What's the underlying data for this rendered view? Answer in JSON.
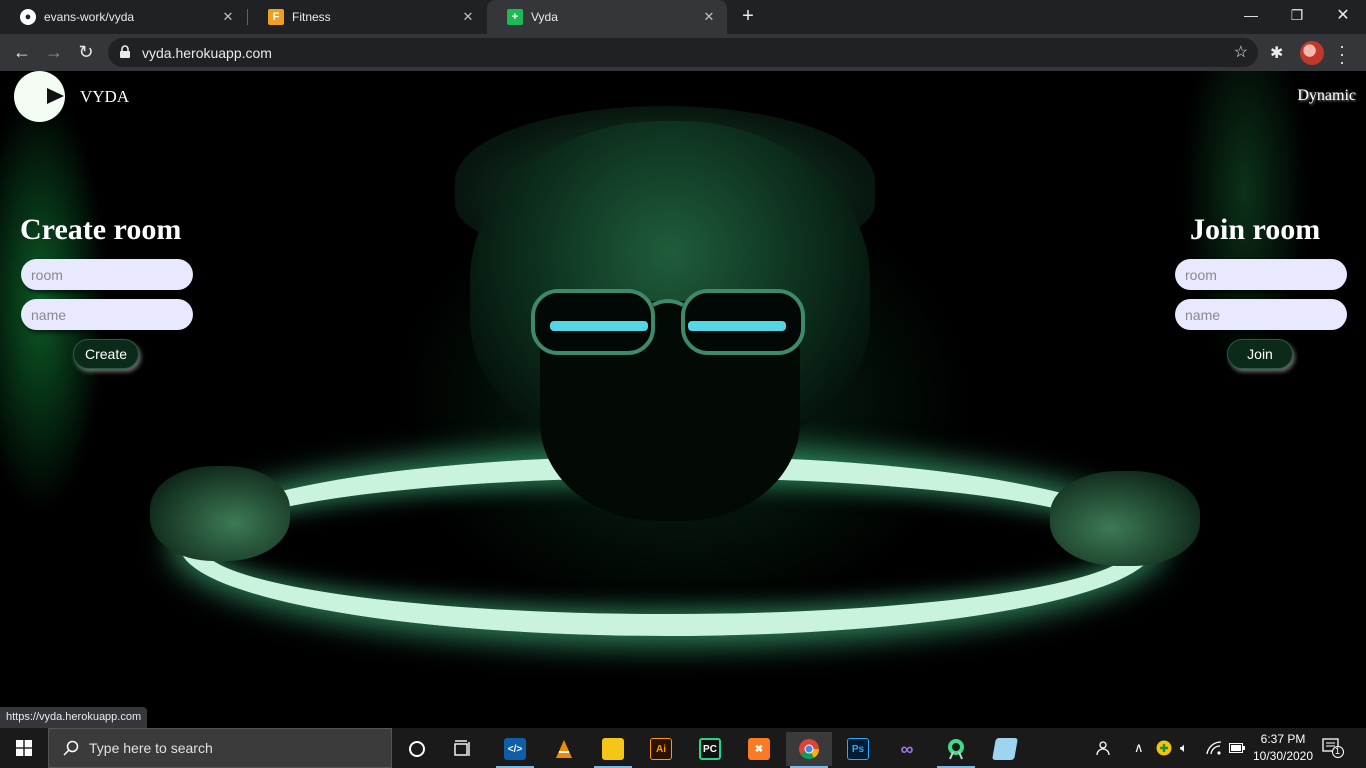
{
  "browser": {
    "tabs": [
      {
        "title": "evans-work/vyda",
        "favicon": "github-icon"
      },
      {
        "title": "Fitness",
        "favicon": "fitness-f-icon"
      },
      {
        "title": "Vyda",
        "favicon": "vyda-plus-icon",
        "active": true
      }
    ],
    "url": "vyda.herokuapp.com",
    "status_url": "https://vyda.herokuapp.com"
  },
  "page": {
    "brand": "VYDA",
    "top_right": "Dynamic",
    "create": {
      "title": "Create room",
      "room_placeholder": "room",
      "name_placeholder": "name",
      "button": "Create"
    },
    "join": {
      "title": "Join room",
      "room_placeholder": "room",
      "name_placeholder": "name",
      "button": "Join"
    }
  },
  "taskbar": {
    "search_placeholder": "Type here to search",
    "time": "6:37 PM",
    "date": "10/30/2020",
    "notification_count": "1",
    "apps": [
      "cortana-icon",
      "task-view-icon",
      "vscode-icon",
      "vlc-icon",
      "file-explorer-icon",
      "illustrator-icon",
      "pycharm-icon",
      "xampp-icon",
      "chrome-icon",
      "photoshop-icon",
      "visual-studio-icon",
      "android-studio-icon",
      "notepad-icon"
    ]
  },
  "colors": {
    "accent_green": "#0c2a1a",
    "input_bg": "#e8e8ff",
    "ring_glow": "#c9f3dc"
  }
}
